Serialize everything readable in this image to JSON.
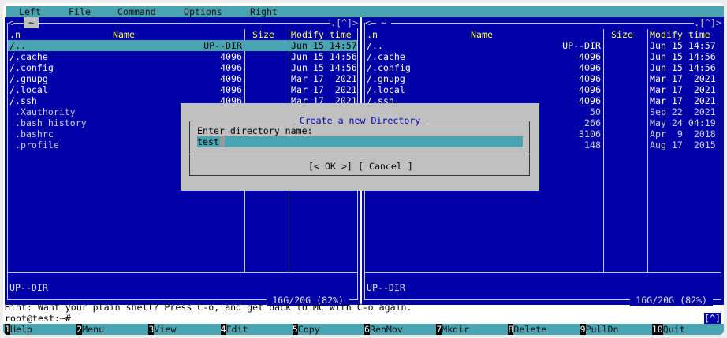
{
  "menu": [
    "Left",
    "File",
    "Command",
    "Options",
    "Right"
  ],
  "left_panel": {
    "path": "~",
    "scroll_indicator": ".[^]>",
    "headers": {
      "sort": ".n",
      "name": "Name",
      "size": "Size",
      "mtime": "Modify time"
    },
    "rows": [
      {
        "name": "/..",
        "size": "UP--DIR",
        "mtime": "Jun 15 14:57",
        "type": "dir",
        "selected": true
      },
      {
        "name": "/.cache",
        "size": "4096",
        "mtime": "Jun 15 14:56",
        "type": "dir"
      },
      {
        "name": "/.config",
        "size": "4096",
        "mtime": "Jun 15 14:56",
        "type": "dir"
      },
      {
        "name": "/.gnupg",
        "size": "4096",
        "mtime": "Mar 17  2021",
        "type": "dir"
      },
      {
        "name": "/.local",
        "size": "4096",
        "mtime": "Mar 17  2021",
        "type": "dir"
      },
      {
        "name": "/.ssh",
        "size": "4096",
        "mtime": "Mar 17  2021",
        "type": "dir"
      },
      {
        "name": " .Xauthority",
        "type": "file"
      },
      {
        "name": " .bash_history",
        "type": "file"
      },
      {
        "name": " .bashrc",
        "type": "file"
      },
      {
        "name": " .profile",
        "type": "file"
      }
    ],
    "status": "UP--DIR",
    "disk": " 16G/20G (82%) "
  },
  "right_panel": {
    "path": "~",
    "scroll_indicator": ".[^]>",
    "headers": {
      "sort": ".n",
      "name": "Name",
      "size": "Size",
      "mtime": "Modify time"
    },
    "rows": [
      {
        "name": "/..",
        "size": "UP--DIR",
        "mtime": "Jun 15 14:57",
        "type": "dir"
      },
      {
        "name": "/.cache",
        "size": "4096",
        "mtime": "Jun 15 14:56",
        "type": "dir"
      },
      {
        "name": "/.config",
        "size": "4096",
        "mtime": "Jun 15 14:56",
        "type": "dir"
      },
      {
        "name": "/.gnupg",
        "size": "4096",
        "mtime": "Mar 17  2021",
        "type": "dir"
      },
      {
        "name": "/.local",
        "size": "4096",
        "mtime": "Mar 17  2021",
        "type": "dir"
      },
      {
        "name": "/.ssh",
        "size": "4096",
        "mtime": "Mar 17  2021",
        "type": "dir"
      },
      {
        "name": "",
        "size": "50",
        "mtime": "Sep 22  2021",
        "type": "file"
      },
      {
        "name": "",
        "size": "266",
        "mtime": "May 24 04:19",
        "type": "file"
      },
      {
        "name": "",
        "size": "3106",
        "mtime": "Apr  9  2018",
        "type": "file"
      },
      {
        "name": "",
        "size": "148",
        "mtime": "Aug 17  2015",
        "type": "file"
      }
    ],
    "status": "UP--DIR",
    "disk": " 16G/20G (82%) "
  },
  "dialog": {
    "title": " Create a new Directory ",
    "label": "Enter directory name:",
    "value": "test",
    "ok": "[< OK >]",
    "cancel": "[ Cancel ]"
  },
  "hint": "Hint: Want your plain shell? Press C-o, and get back to MC with C-o again.",
  "prompt": "root@test:~#",
  "prompt_indicator": "[^]",
  "fkeys": [
    {
      "n": "1",
      "l": "Help"
    },
    {
      "n": "2",
      "l": "Menu"
    },
    {
      "n": "3",
      "l": "View"
    },
    {
      "n": "4",
      "l": "Edit"
    },
    {
      "n": "5",
      "l": "Copy"
    },
    {
      "n": "6",
      "l": "RenMov"
    },
    {
      "n": "7",
      "l": "Mkdir"
    },
    {
      "n": "8",
      "l": "Delete"
    },
    {
      "n": "9",
      "l": "PullDn"
    },
    {
      "n": "10",
      "l": "Quit"
    }
  ]
}
